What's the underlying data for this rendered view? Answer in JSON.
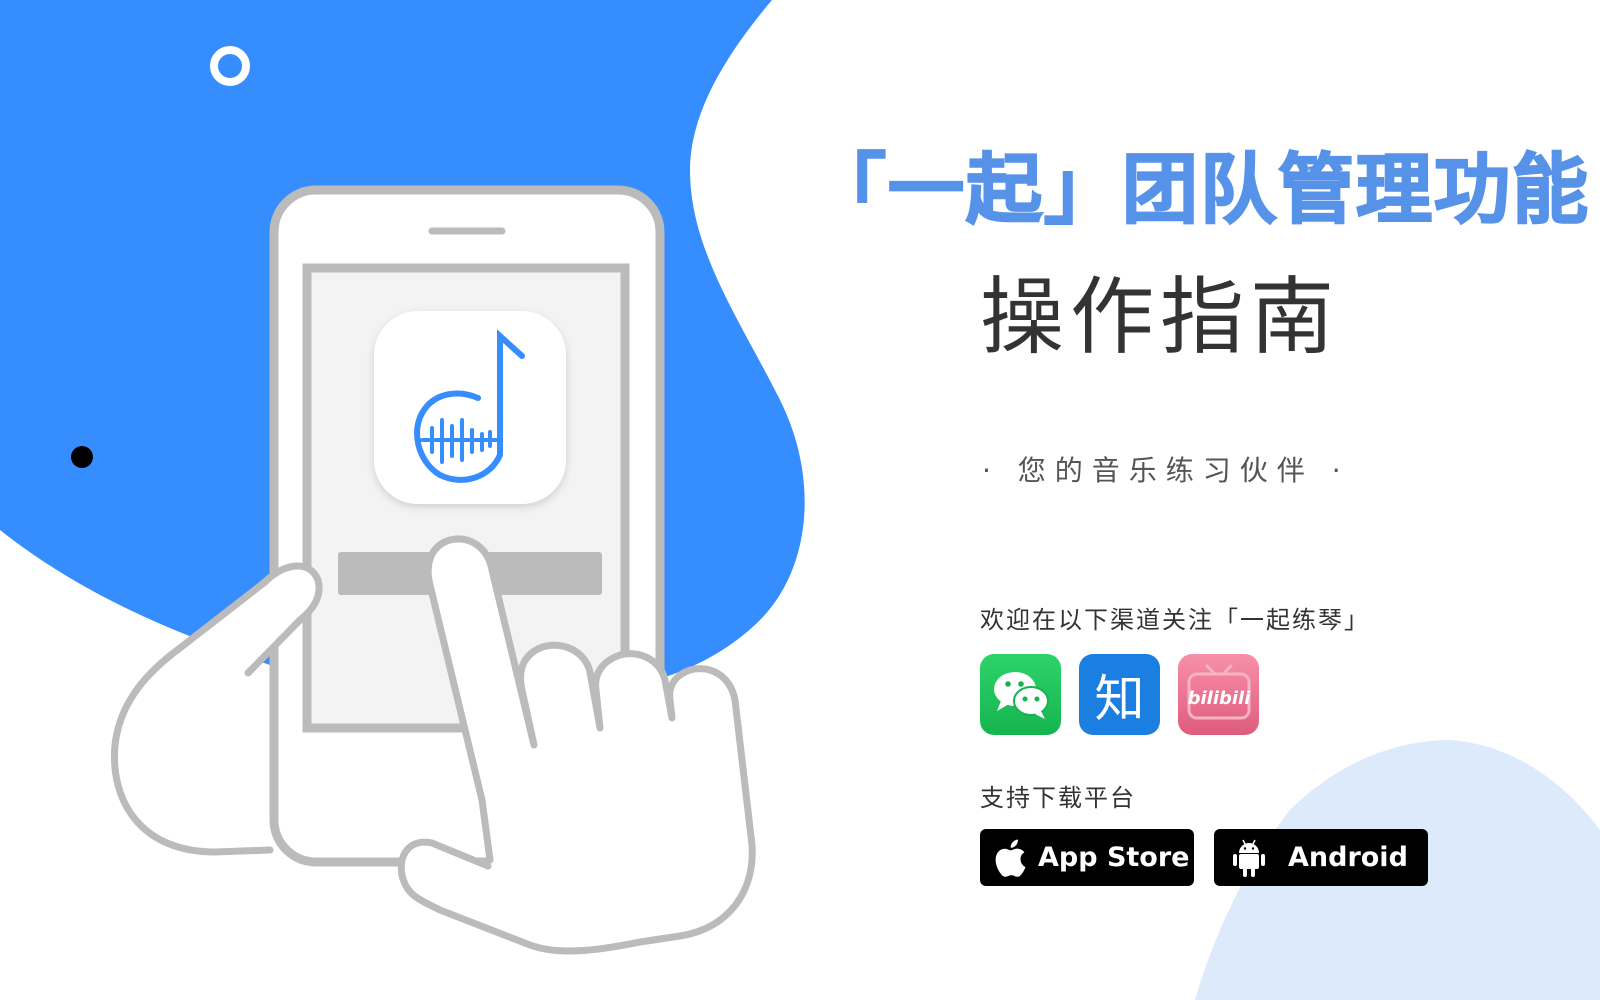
{
  "header": {
    "title": "「一起」团队管理功能",
    "subtitle": "操作指南",
    "tagline": "· 您的音乐练习伙伴 ·"
  },
  "follow": {
    "label": "欢迎在以下渠道关注「一起练琴」",
    "channels": [
      {
        "name": "WeChat",
        "icon": "wechat-icon",
        "glyph": ""
      },
      {
        "name": "Zhihu",
        "icon": "zhihu-icon",
        "glyph": "知"
      },
      {
        "name": "Bilibili",
        "icon": "bilibili-icon",
        "glyph": "bilibili"
      }
    ]
  },
  "download": {
    "label": "支持下载平台",
    "platforms": [
      {
        "label": "App Store",
        "icon": "apple-icon"
      },
      {
        "label": "Android",
        "icon": "android-icon"
      }
    ]
  },
  "colors": {
    "primary_blue": "#368dfe",
    "title_blue": "#5693e8",
    "light_blue": "#dceafb",
    "outline_gray": "#bbbbbb"
  },
  "illustration": {
    "app_icon": "music-note-waveform-icon",
    "description": "hands-holding-phone"
  }
}
